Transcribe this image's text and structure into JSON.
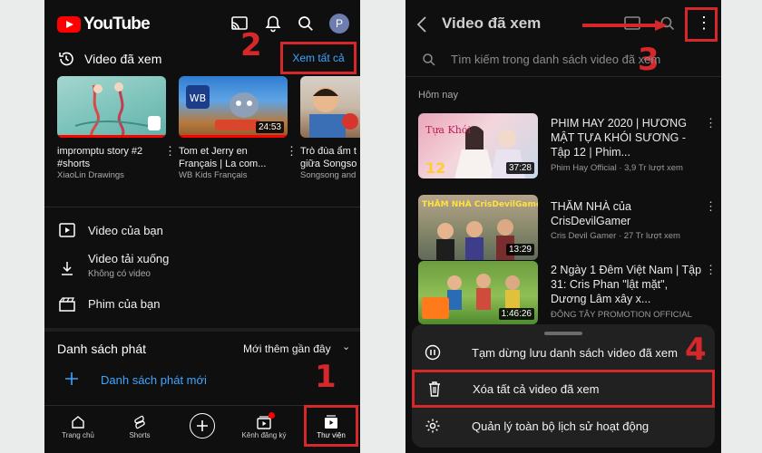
{
  "left": {
    "header": {
      "logo_text": "YouTube",
      "avatar_letter": "P"
    },
    "history": {
      "title": "Video đã xem",
      "see_all": "Xem tất cả"
    },
    "videos": [
      {
        "title": "impromptu story #2 #shorts",
        "channel": "XiaoLin Drawings",
        "duration": ""
      },
      {
        "title": "Tom et Jerry en Français | La com...",
        "channel": "WB Kids Français",
        "duration": "24:53"
      },
      {
        "title": "Trò đùa ẩm t giữa Songso",
        "channel": "Songsong and",
        "duration": ""
      }
    ],
    "library": [
      {
        "label": "Video của bạn",
        "sub": ""
      },
      {
        "label": "Video tải xuống",
        "sub": "Không có video"
      },
      {
        "label": "Phim của bạn",
        "sub": ""
      }
    ],
    "playlists": {
      "title": "Danh sách phát",
      "sort": "Mới thêm gần đây",
      "new_playlist": "Danh sách phát mới"
    },
    "nav": [
      "Trang chủ",
      "Shorts",
      "",
      "Kênh đăng ký",
      "Thư viện"
    ]
  },
  "right": {
    "title": "Video đã xem",
    "search_placeholder": "Tìm kiếm trong danh sách video đã xem",
    "section": "Hôm nay",
    "items": [
      {
        "title": "PHIM HAY 2020 | HƯƠNG MẬT TỰA KHÓI SƯƠNG - Tập 12 | Phim...",
        "sub": "Phim Hay Official · 3,9 Tr lượt xem",
        "duration": "37:28"
      },
      {
        "title": "THĂM NHÀ của CrisDevilGamer",
        "sub": "Cris Devil Gamer · 27 Tr lượt xem",
        "duration": "13:29"
      },
      {
        "title": "2 Ngày 1 Đêm Việt Nam | Tập 31: Cris Phan \"lật mặt\", Dương Lâm xây x...",
        "sub": "ĐÔNG TÂY PROMOTION OFFICIAL",
        "duration": "1:46:26"
      }
    ],
    "menu": [
      "Tạm dừng lưu danh sách video đã xem",
      "Xóa tất cả video đã xem",
      "Quản lý toàn bộ lịch sử hoạt động"
    ]
  },
  "annotations": [
    "1",
    "2",
    "3",
    "4"
  ],
  "colors": {
    "accent_red": "#d6282b",
    "link_blue": "#3ea6ff",
    "yt_red": "#ff0000"
  }
}
